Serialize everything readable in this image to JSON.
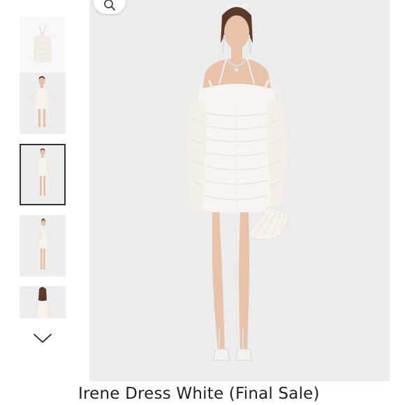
{
  "product": {
    "title": "Irene Dress White (Final Sale)"
  },
  "gallery": {
    "thumbnail_count_visible": 5,
    "selected_index": 2,
    "main_image_icon": "product-photo-icon",
    "zoom_icon": "magnifier-icon",
    "scroll_icon": "chevron-down-icon"
  },
  "colors": {
    "main_image_bg": "#ececec",
    "thumb_bg": "#efefef",
    "dress": "#f7f5f1",
    "skin": "#e6c3aa",
    "hair": "#5a3a2a",
    "lace": "#f3efe9",
    "title_text": "#222222"
  }
}
